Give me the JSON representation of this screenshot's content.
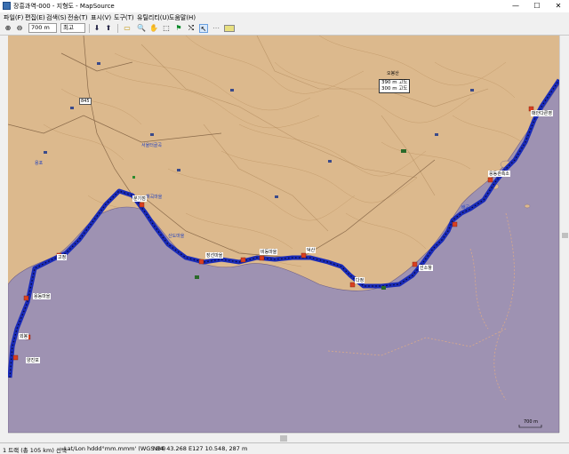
{
  "window": {
    "title": "장흥과역-000 - 지형도 - MapSource",
    "minimize": "—",
    "maximize": "☐",
    "close": "✕"
  },
  "menu": [
    "파일(F)",
    "편집(E)",
    "검색(S)",
    "전송(T)",
    "표시(V)",
    "도구(T)",
    "유틸리티(U)",
    "도움말(H)"
  ],
  "toolbar": {
    "zoom_value": "700 m",
    "detail_value": "최고"
  },
  "map": {
    "labels": [
      {
        "text": "845",
        "cls": "road"
      },
      {
        "text": "오봉산",
        "cls": "peak"
      },
      {
        "text": "서울터골곡",
        "cls": "blue"
      },
      {
        "text": "해곡마을",
        "cls": "blue"
      },
      {
        "text": "덕산",
        "cls": "blue"
      },
      {
        "text": "비동마을",
        "cls": "blue"
      },
      {
        "text": "장선마을",
        "cls": "blue"
      },
      {
        "text": "산도마을",
        "cls": "blue"
      },
      {
        "text": "고정",
        "cls": "blue"
      },
      {
        "text": "다정",
        "cls": "blue"
      },
      {
        "text": "웅동관측소",
        "cls": "blue"
      },
      {
        "text": "선소항",
        "cls": "blue"
      },
      {
        "text": "외봉",
        "cls": "blue"
      },
      {
        "text": "용동마을",
        "cls": "blue"
      },
      {
        "text": "분기점",
        "cls": "blue"
      },
      {
        "text": "배곡",
        "cls": "blue"
      },
      {
        "text": "양진포",
        "cls": "blue"
      },
      {
        "text": "용포",
        "cls": "blue"
      },
      {
        "text": "매안다른영",
        "cls": "blue"
      }
    ],
    "peak_box": {
      "line1": "390 m 고도",
      "line2": "300 m 고도"
    },
    "scale_label": "700 m"
  },
  "statusbar": {
    "selection": "1 트랙 (총 105 km) 선택",
    "format": "Lat/Lon hddd°mm.mmm' (WGS 84)",
    "position": "N34 43.268 E127 10.548, 287 m"
  }
}
